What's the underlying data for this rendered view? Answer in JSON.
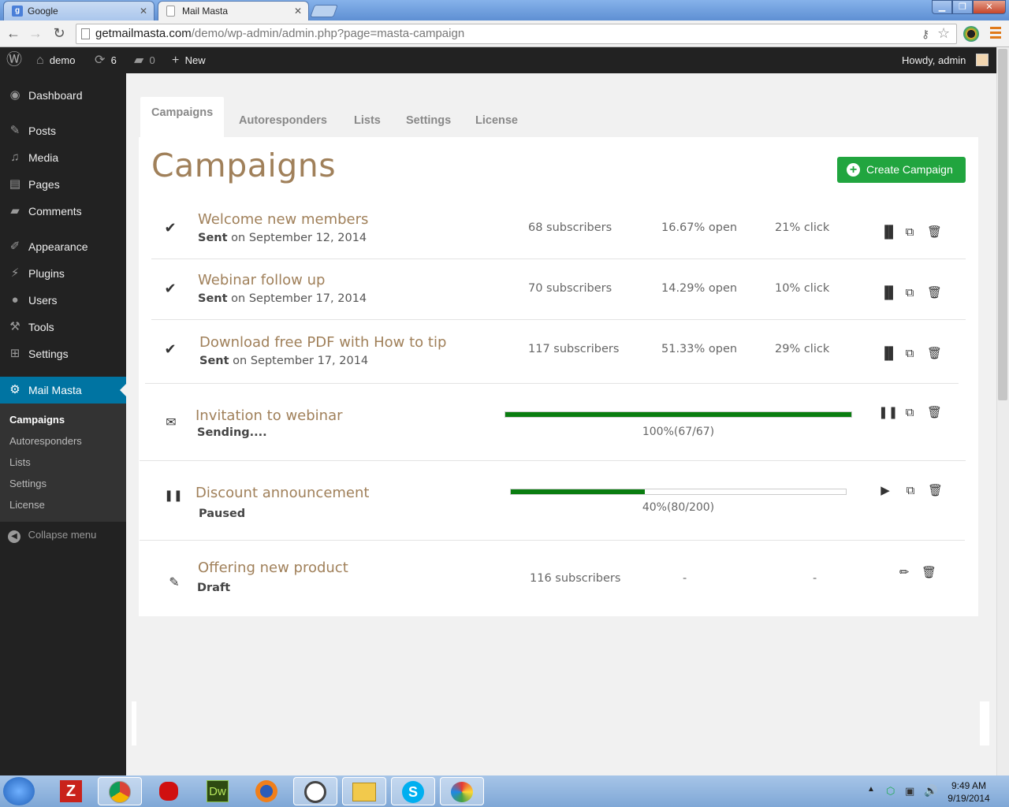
{
  "browser": {
    "tabs": [
      {
        "title": "Google",
        "active": false
      },
      {
        "title": "Mail Masta",
        "active": true
      }
    ],
    "url_host": "getmailmasta.com",
    "url_path": "/demo/wp-admin/admin.php?page=masta-campaign"
  },
  "adminbar": {
    "site_name": "demo",
    "updates_count": "6",
    "comments_count": "0",
    "new_label": "New",
    "howdy": "Howdy, admin"
  },
  "sidebar": {
    "items": [
      {
        "label": "Dashboard",
        "icon": "dashboard-icon"
      },
      {
        "label": "Posts",
        "icon": "pin-icon"
      },
      {
        "label": "Media",
        "icon": "media-icon"
      },
      {
        "label": "Pages",
        "icon": "pages-icon"
      },
      {
        "label": "Comments",
        "icon": "comment-icon"
      },
      {
        "label": "Appearance",
        "icon": "brush-icon"
      },
      {
        "label": "Plugins",
        "icon": "plug-icon"
      },
      {
        "label": "Users",
        "icon": "user-icon"
      },
      {
        "label": "Tools",
        "icon": "wrench-icon"
      },
      {
        "label": "Settings",
        "icon": "settings-icon"
      },
      {
        "label": "Mail Masta",
        "icon": "gear-icon"
      }
    ],
    "submenu": [
      "Campaigns",
      "Autoresponders",
      "Lists",
      "Settings",
      "License"
    ],
    "collapse": "Collapse menu"
  },
  "plugin_tabs": [
    "Campaigns",
    "Autoresponders",
    "Lists",
    "Settings",
    "License"
  ],
  "page_title": "Campaigns",
  "create_button": "Create Campaign",
  "campaigns": [
    {
      "name": "Welcome new members",
      "status_bold": "Sent",
      "status_rest": " on September 12, 2014",
      "subscribers": "68 subscribers",
      "open": "16.67% open",
      "click": "21% click"
    },
    {
      "name": "Webinar follow up",
      "status_bold": "Sent",
      "status_rest": " on September 17, 2014",
      "subscribers": "70 subscribers",
      "open": "14.29% open",
      "click": "10% click"
    },
    {
      "name": "Download free PDF with How to tip",
      "status_bold": "Sent",
      "status_rest": " on September 17, 2014",
      "subscribers": "117 subscribers",
      "open": "51.33% open",
      "click": "29% click"
    },
    {
      "name": "Invitation to webinar",
      "status_bold": "Sending....",
      "progress": 1.0,
      "progress_label": "100%(67/67)"
    },
    {
      "name": "Discount announcement",
      "status_bold": "Paused",
      "progress": 0.4,
      "progress_label": "40%(80/200)"
    },
    {
      "name": "Offering new product",
      "status_bold": "Draft",
      "subscribers": "116 subscribers",
      "open": "-",
      "click": "-"
    }
  ],
  "taskbar": {
    "time": "9:49 AM",
    "date": "9/19/2014"
  },
  "colors": {
    "accent_brown": "#a0805a",
    "create_green": "#21a53f",
    "progress_green": "#0a7d10",
    "wp_blue": "#0074a2"
  }
}
